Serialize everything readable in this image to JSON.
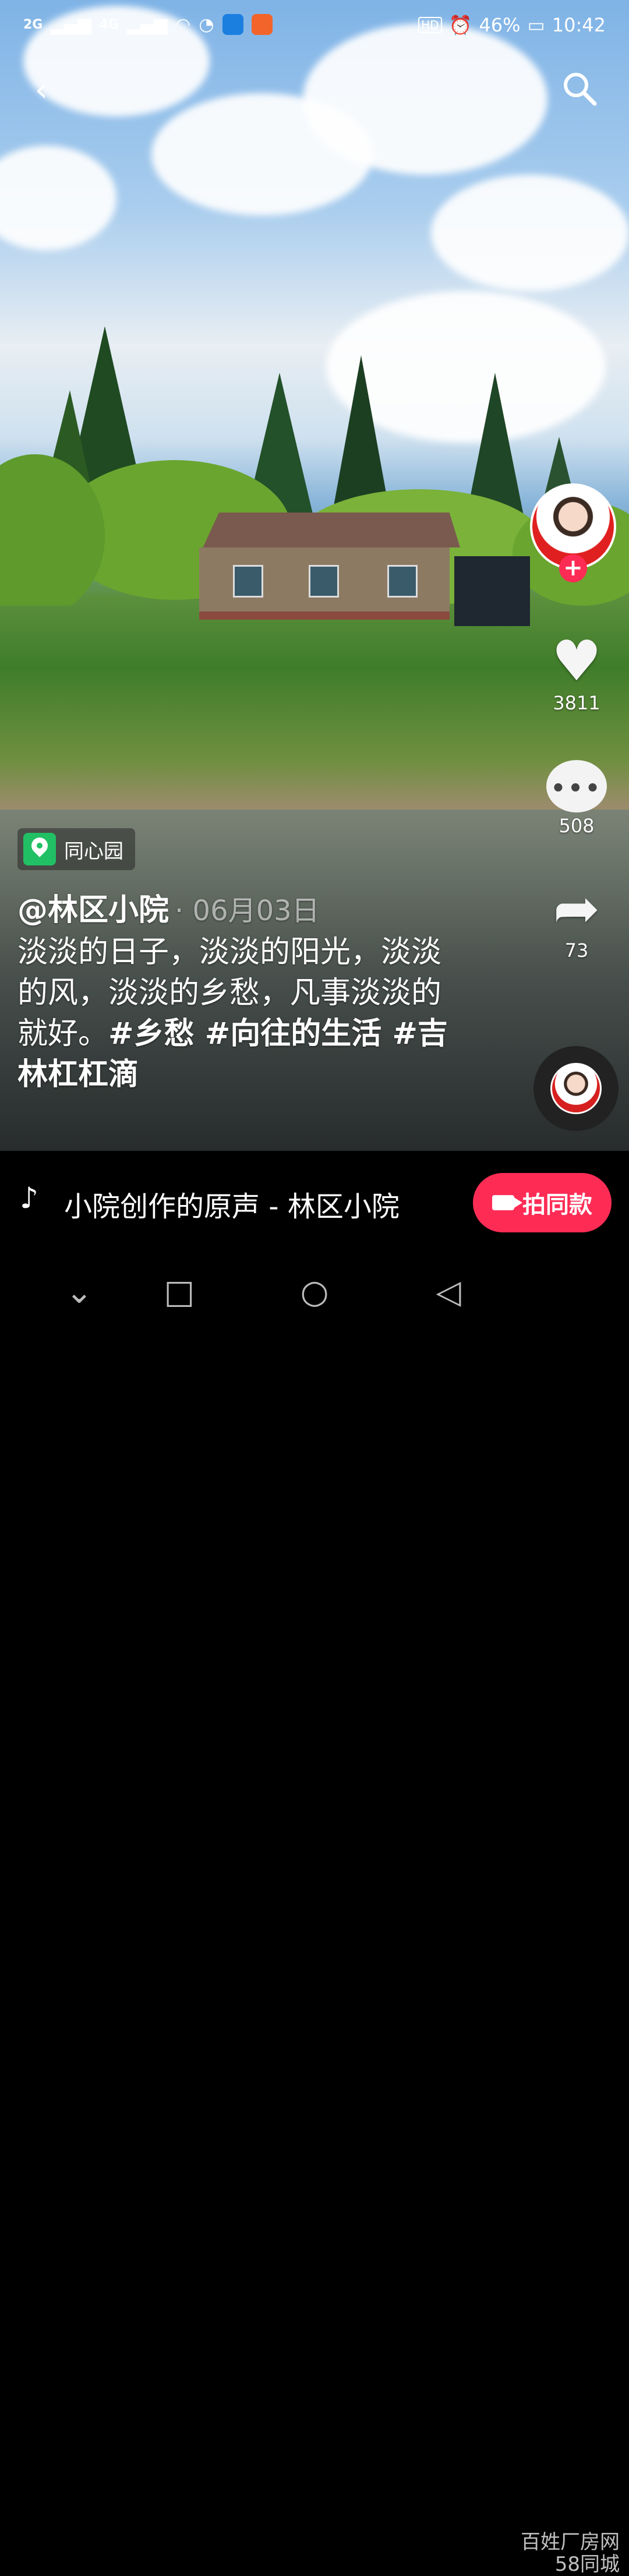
{
  "status": {
    "signal1": "2G",
    "signal2": "4G",
    "hd": "HD",
    "battery": "46%",
    "time": "10:42"
  },
  "top": {
    "back_icon": "back-arrow-icon",
    "search_icon": "search-icon"
  },
  "rail": {
    "likes": "3811",
    "comments": "508",
    "shares": "73"
  },
  "location": "同心园",
  "author": "@林区小院",
  "date": "· 06月03日",
  "caption": {
    "text": "淡淡的日子，淡淡的阳光，淡淡的风，淡淡的乡愁，凡事淡淡的就好。",
    "tags": "#乡愁 #向往的生活 #吉林杠杠滴"
  },
  "music": {
    "title": "小院创作的原声 - 林区小院",
    "button": "拍同款"
  },
  "watermark": {
    "line1": "百姓厂房网",
    "line2": "58同城"
  },
  "colors": {
    "accent": "#fe2c55",
    "location_pin": "#21c064"
  }
}
